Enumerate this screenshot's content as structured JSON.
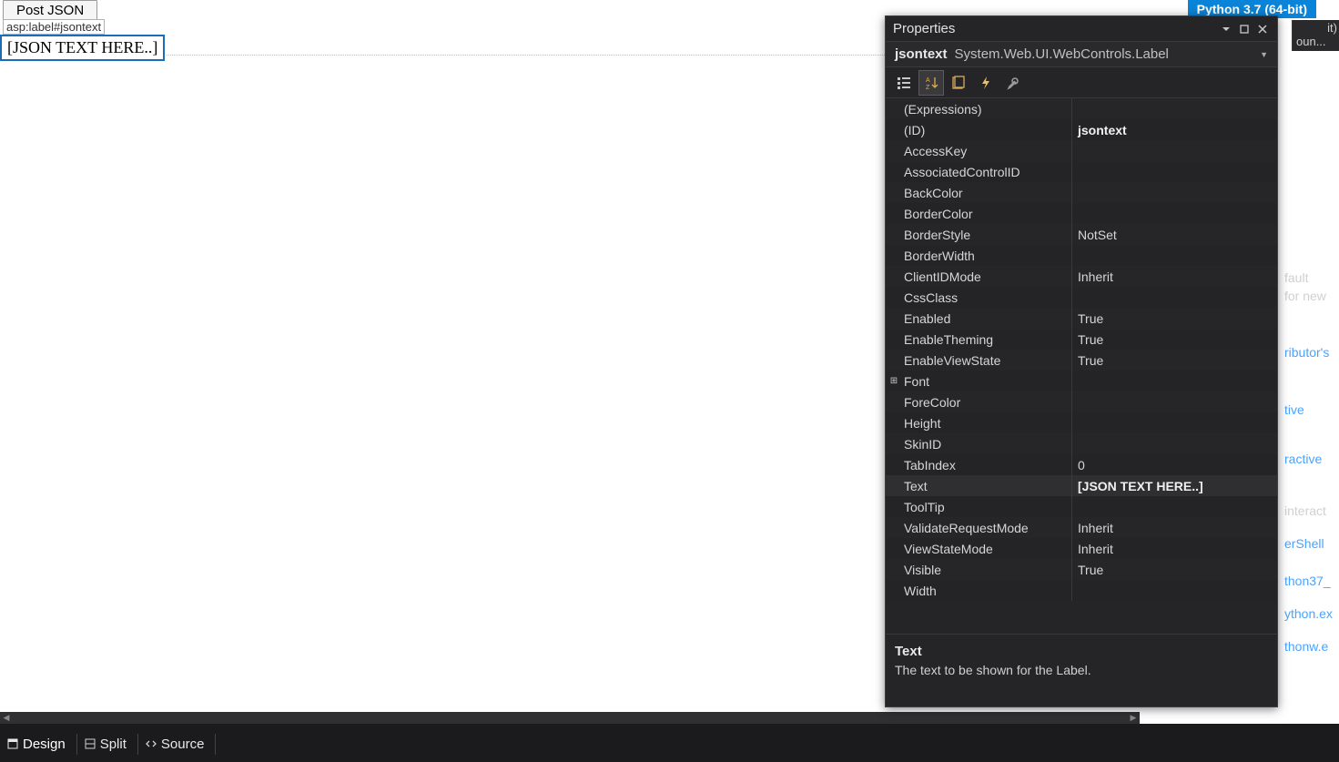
{
  "designer": {
    "button_label": "Post JSON",
    "tag_label": "asp:label#jsontext",
    "selected_text": "[JSON TEXT HERE..]"
  },
  "python_badge": "Python 3.7 (64-bit)",
  "frag": {
    "top1_line1": "it)",
    "top1_line2": "oun...",
    "r1": "fault",
    "r2": "for new",
    "r3": "ributor's",
    "r4": "tive",
    "r5": "ractive",
    "r6": "interact",
    "r7": "erShell",
    "r8": "thon37_",
    "r9": "ython.ex",
    "r10": "thonw.e"
  },
  "tabs": {
    "design": "Design",
    "split": "Split",
    "source": "Source"
  },
  "properties": {
    "panel_title": "Properties",
    "object_name": "jsontext",
    "object_type": "System.Web.UI.WebControls.Label",
    "desc_title": "Text",
    "desc_text": "The text to be shown for the Label.",
    "rows": [
      {
        "name": "(Expressions)",
        "value": "",
        "exp": ""
      },
      {
        "name": "(ID)",
        "value": "jsontext",
        "bold": true
      },
      {
        "name": "AccessKey",
        "value": ""
      },
      {
        "name": "AssociatedControlID",
        "value": ""
      },
      {
        "name": "BackColor",
        "value": ""
      },
      {
        "name": "BorderColor",
        "value": ""
      },
      {
        "name": "BorderStyle",
        "value": "NotSet"
      },
      {
        "name": "BorderWidth",
        "value": ""
      },
      {
        "name": "ClientIDMode",
        "value": "Inherit"
      },
      {
        "name": "CssClass",
        "value": ""
      },
      {
        "name": "Enabled",
        "value": "True"
      },
      {
        "name": "EnableTheming",
        "value": "True"
      },
      {
        "name": "EnableViewState",
        "value": "True"
      },
      {
        "name": "Font",
        "value": "",
        "exp": "+"
      },
      {
        "name": "ForeColor",
        "value": ""
      },
      {
        "name": "Height",
        "value": ""
      },
      {
        "name": "SkinID",
        "value": ""
      },
      {
        "name": "TabIndex",
        "value": "0"
      },
      {
        "name": "Text",
        "value": "[JSON TEXT HERE..]",
        "bold": true,
        "selected": true
      },
      {
        "name": "ToolTip",
        "value": ""
      },
      {
        "name": "ValidateRequestMode",
        "value": "Inherit"
      },
      {
        "name": "ViewStateMode",
        "value": "Inherit"
      },
      {
        "name": "Visible",
        "value": "True"
      },
      {
        "name": "Width",
        "value": ""
      }
    ]
  }
}
